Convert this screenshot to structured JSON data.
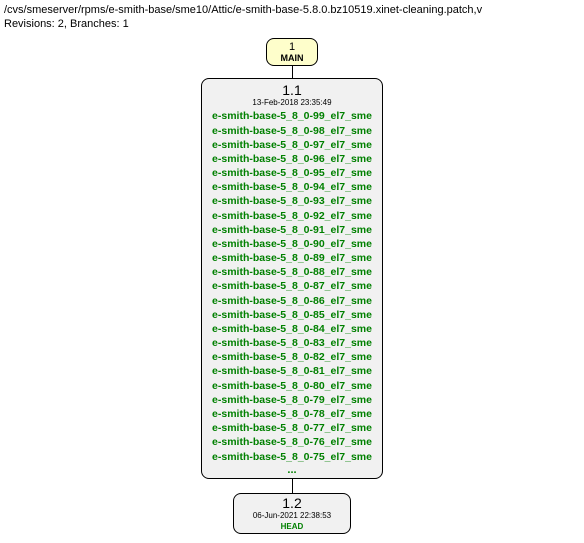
{
  "path": "/cvs/smeserver/rpms/e-smith-base/sme10/Attic/e-smith-base-5.8.0.bz10519.xinet-cleaning.patch,v",
  "info": "Revisions: 2, Branches: 1",
  "branch_root": {
    "num": "1",
    "label": "MAIN"
  },
  "revision_1": {
    "version": "1.1",
    "timestamp": "13-Feb-2018 23:35:49",
    "tags": [
      "e-smith-base-5_8_0-99_el7_sme",
      "e-smith-base-5_8_0-98_el7_sme",
      "e-smith-base-5_8_0-97_el7_sme",
      "e-smith-base-5_8_0-96_el7_sme",
      "e-smith-base-5_8_0-95_el7_sme",
      "e-smith-base-5_8_0-94_el7_sme",
      "e-smith-base-5_8_0-93_el7_sme",
      "e-smith-base-5_8_0-92_el7_sme",
      "e-smith-base-5_8_0-91_el7_sme",
      "e-smith-base-5_8_0-90_el7_sme",
      "e-smith-base-5_8_0-89_el7_sme",
      "e-smith-base-5_8_0-88_el7_sme",
      "e-smith-base-5_8_0-87_el7_sme",
      "e-smith-base-5_8_0-86_el7_sme",
      "e-smith-base-5_8_0-85_el7_sme",
      "e-smith-base-5_8_0-84_el7_sme",
      "e-smith-base-5_8_0-83_el7_sme",
      "e-smith-base-5_8_0-82_el7_sme",
      "e-smith-base-5_8_0-81_el7_sme",
      "e-smith-base-5_8_0-80_el7_sme",
      "e-smith-base-5_8_0-79_el7_sme",
      "e-smith-base-5_8_0-78_el7_sme",
      "e-smith-base-5_8_0-77_el7_sme",
      "e-smith-base-5_8_0-76_el7_sme",
      "e-smith-base-5_8_0-75_el7_sme"
    ],
    "ellipsis": "..."
  },
  "revision_2": {
    "version": "1.2",
    "timestamp": "06-Jun-2021 22:38:53",
    "head": "HEAD"
  }
}
